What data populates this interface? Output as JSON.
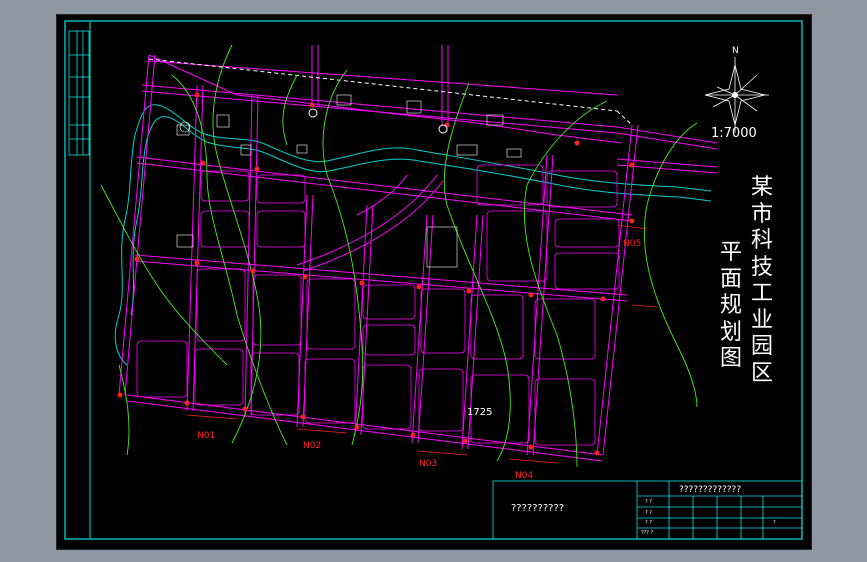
{
  "drawing": {
    "title_col1": [
      "某",
      "市",
      "科",
      "技",
      "工",
      "业",
      "园",
      "区"
    ],
    "title_col2": [
      "平",
      "面",
      "规",
      "划",
      "图"
    ],
    "scale": "1:7000",
    "north_letter": "N",
    "section_labels": [
      "N01",
      "N02",
      "N03",
      "N04",
      "N05"
    ],
    "block_label": "1725",
    "colors": {
      "background": "#000000",
      "frame": "#00e5e5",
      "roads": "#ff00ff",
      "section_markers": "#ff2020",
      "contours": "#44ee22",
      "labels": "#ffffff"
    }
  },
  "title_block": {
    "header": "?????????????",
    "project_name": "??????????",
    "row_labels": [
      "? ?",
      "? ?",
      "? ?",
      "??? ?"
    ],
    "sheet_no": "?"
  }
}
